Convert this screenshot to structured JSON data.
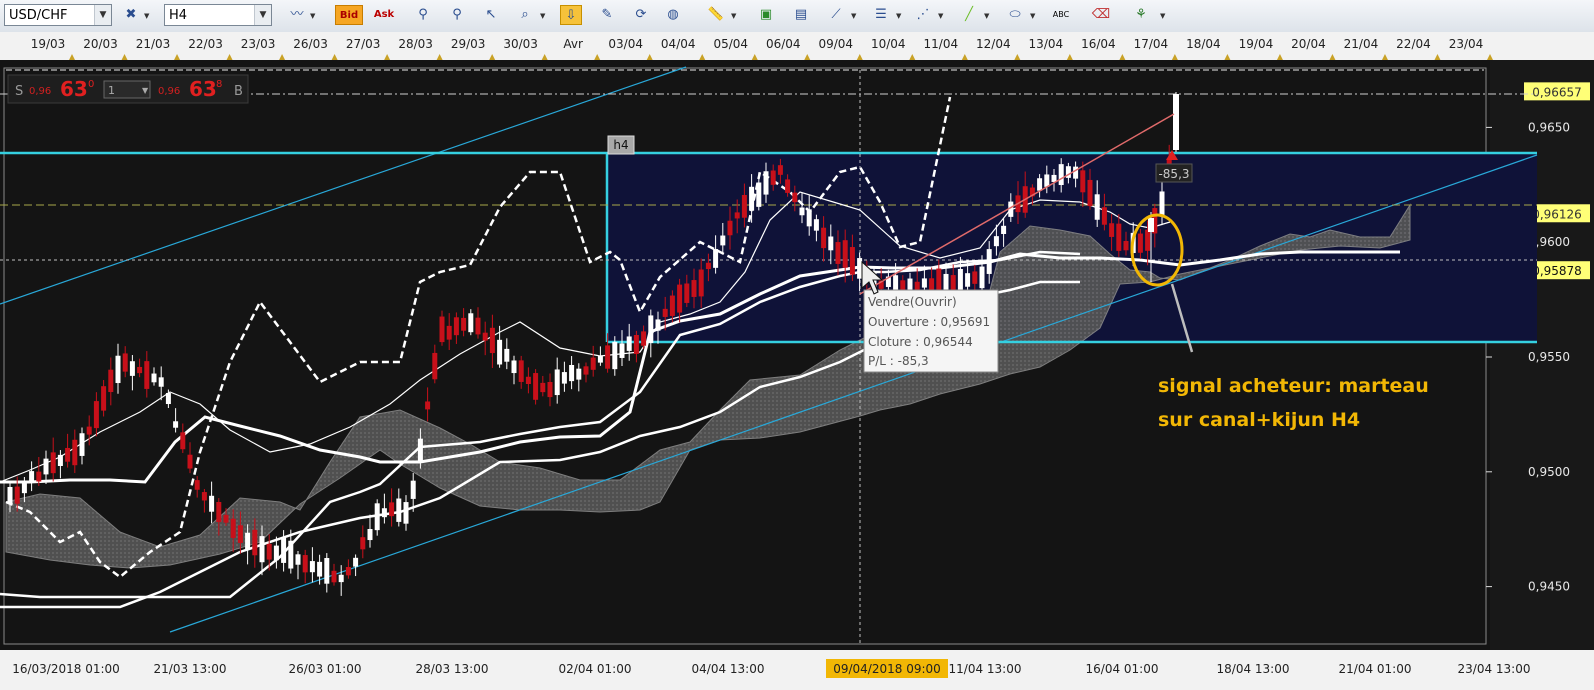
{
  "toolbar": {
    "symbol": "USD/CHF",
    "timeframe": "H4",
    "bid_label": "Bid",
    "ask_label": "Ask",
    "icons": [
      "chart-type-icon",
      "chart-line-icon",
      "bid-icon",
      "ask-icon",
      "zoom-in-icon",
      "zoom-out-icon",
      "cursor-icon",
      "zoom-area-icon",
      "trend-icon",
      "news-icon",
      "refresh-icon",
      "globe-icon",
      "ruler-icon",
      "image-icon",
      "template-icon",
      "tools-icon",
      "lines-icon",
      "fib-icon",
      "pencil-icon",
      "ellipse-icon",
      "abc-text-icon",
      "eraser-icon",
      "tree-icon"
    ]
  },
  "quote_panel": {
    "sell_letter": "S",
    "sell_small": "0,96",
    "sell_big": "63",
    "sell_sup": "0",
    "qty": "1",
    "buy_small": "0,96",
    "buy_big": "63",
    "buy_sup": "8",
    "buy_letter": "B"
  },
  "top_dates": [
    "19/03",
    "20/03",
    "21/03",
    "22/03",
    "23/03",
    "26/03",
    "27/03",
    "28/03",
    "29/03",
    "30/03",
    "Avr",
    "03/04",
    "04/04",
    "05/04",
    "06/04",
    "09/04",
    "10/04",
    "11/04",
    "12/04",
    "13/04",
    "16/04",
    "17/04",
    "18/04",
    "19/04",
    "20/04",
    "21/04",
    "22/04",
    "23/04"
  ],
  "bottom_dates": [
    "16/03/2018 01:00",
    "21/03 13:00",
    "26/03 01:00",
    "28/03 13:00",
    "02/04 01:00",
    "04/04 13:00",
    "09/04/2018 09:00",
    "11/04 13:00",
    "16/04 01:00",
    "18/04 13:00",
    "21/04 01:00",
    "23/04 13:00"
  ],
  "price_labels": [
    "0,9650",
    "0,9600",
    "0,9550",
    "0,9500",
    "0,9450"
  ],
  "price_markers": {
    "current": "0,96657",
    "level_a": "0,96126",
    "level_b": "0,95878"
  },
  "box_label": "h4",
  "trade_marker": "-85,3",
  "tooltip": {
    "line1": "Vendre(Ouvrir)",
    "line2": "Ouverture : 0,95691",
    "line3": "Cloture : 0,96544",
    "line4": "P/L : -85,3"
  },
  "annotation": {
    "line1": "signal acheteur: marteau",
    "line2": "sur canal+kijun H4"
  },
  "colors": {
    "background": "#131313",
    "box": "#0f1238",
    "box_border": "#35d0e0",
    "channel": "#29a8d8",
    "bull": "#ffffff",
    "bear": "#c8101a",
    "annotation": "#f2b705",
    "marker_bg": "#ffff77",
    "cloud": "#7a7a7a"
  },
  "chart_data": {
    "type": "line",
    "title": "",
    "symbol": "USD/CHF",
    "timeframe": "H4",
    "y_range": [
      0.9425,
      0.9675
    ],
    "grid": "none",
    "y_ticks": [
      0.965,
      0.96,
      0.955,
      0.95,
      0.945
    ],
    "series": [
      {
        "x_dates": [
          "16/03",
          "21/03",
          "26/03",
          "28/03",
          "02/04",
          "04/04",
          "09/04",
          "11/04",
          "16/04",
          "17/04"
        ],
        "values": [
          0.9487,
          0.9548,
          0.9452,
          0.9585,
          0.9552,
          0.9557,
          0.961,
          0.9585,
          0.96,
          0.9666
        ]
      }
    ],
    "levels": {
      "current": 0.96657,
      "level_a": 0.96126,
      "level_b": 0.95878,
      "box_top": 0.9636,
      "box_bottom": 0.9551
    }
  }
}
